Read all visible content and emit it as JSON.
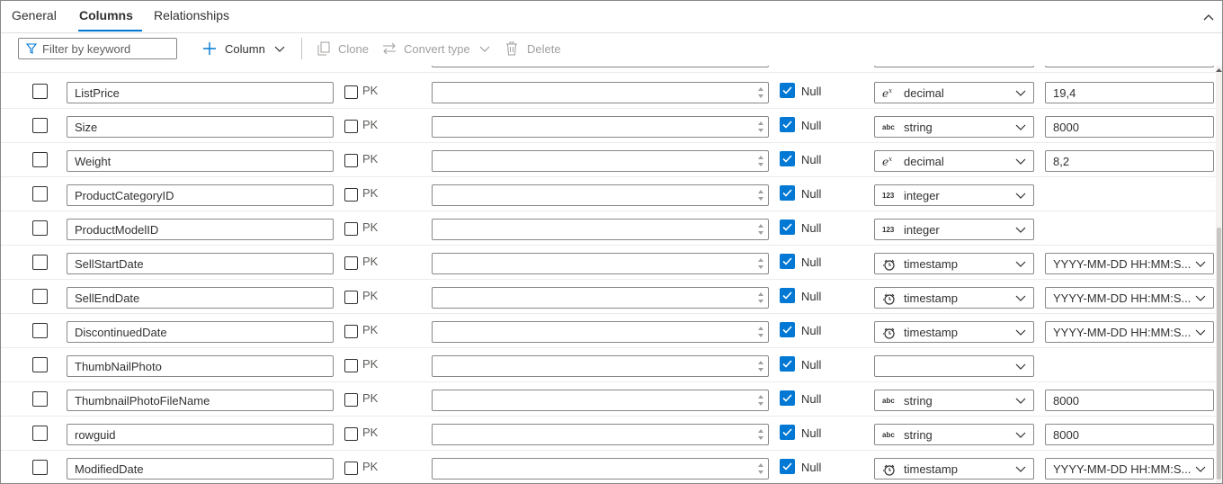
{
  "tabs": [
    {
      "label": "General"
    },
    {
      "label": "Columns"
    },
    {
      "label": "Relationships"
    }
  ],
  "toolbar": {
    "filter_placeholder": "Filter by keyword",
    "add_column_label": "Column",
    "clone_label": "Clone",
    "convert_type_label": "Convert type",
    "delete_label": "Delete"
  },
  "labels": {
    "pk": "PK",
    "null": "Null"
  },
  "rows": [
    {
      "name": "ListPrice",
      "type": "decimal",
      "type_icon": "decimal-icon",
      "format": "19,4",
      "format_dropdown": false
    },
    {
      "name": "Size",
      "type": "string",
      "type_icon": "string-icon",
      "format": "8000",
      "format_dropdown": false
    },
    {
      "name": "Weight",
      "type": "decimal",
      "type_icon": "decimal-icon",
      "format": "8,2",
      "format_dropdown": false
    },
    {
      "name": "ProductCategoryID",
      "type": "integer",
      "type_icon": "integer-icon",
      "format": "",
      "format_dropdown": null
    },
    {
      "name": "ProductModelID",
      "type": "integer",
      "type_icon": "integer-icon",
      "format": "",
      "format_dropdown": null
    },
    {
      "name": "SellStartDate",
      "type": "timestamp",
      "type_icon": "timestamp-icon",
      "format": "YYYY-MM-DD HH:MM:S...",
      "format_dropdown": true
    },
    {
      "name": "SellEndDate",
      "type": "timestamp",
      "type_icon": "timestamp-icon",
      "format": "YYYY-MM-DD HH:MM:S...",
      "format_dropdown": true
    },
    {
      "name": "DiscontinuedDate",
      "type": "timestamp",
      "type_icon": "timestamp-icon",
      "format": "YYYY-MM-DD HH:MM:S...",
      "format_dropdown": true
    },
    {
      "name": "ThumbNailPhoto",
      "type": "",
      "type_icon": "",
      "format": "",
      "format_dropdown": null
    },
    {
      "name": "ThumbnailPhotoFileName",
      "type": "string",
      "type_icon": "string-icon",
      "format": "8000",
      "format_dropdown": false
    },
    {
      "name": "rowguid",
      "type": "string",
      "type_icon": "string-icon",
      "format": "8000",
      "format_dropdown": false
    },
    {
      "name": "ModifiedDate",
      "type": "timestamp",
      "type_icon": "timestamp-icon",
      "format": "YYYY-MM-DD HH:MM:S...",
      "format_dropdown": true
    }
  ],
  "colors": {
    "accent": "#0078d4",
    "border": "#8a8886",
    "disabled": "#a19f9d"
  }
}
